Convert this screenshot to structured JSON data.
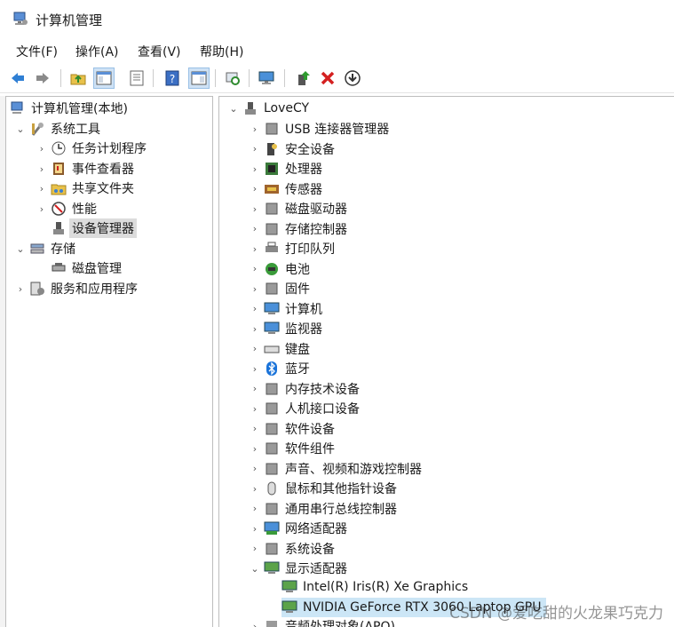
{
  "window": {
    "title": "计算机管理"
  },
  "menu": [
    "文件(F)",
    "操作(A)",
    "查看(V)",
    "帮助(H)"
  ],
  "toolbar": {
    "buttons": [
      "back-icon",
      "forward-icon",
      "up-folder-icon",
      "show-tree-icon",
      "properties-icon",
      "help-icon",
      "action-pane-icon",
      "scan-hardware-icon",
      "monitor-icon",
      "update-driver-icon",
      "uninstall-icon",
      "disable-device-icon"
    ]
  },
  "left_tree": {
    "root": "计算机管理(本地)",
    "system_tools": "系统工具",
    "task_scheduler": "任务计划程序",
    "event_viewer": "事件查看器",
    "shared_folders": "共享文件夹",
    "performance": "性能",
    "device_manager": "设备管理器",
    "storage": "存储",
    "disk_management": "磁盘管理",
    "services_apps": "服务和应用程序"
  },
  "device_tree": {
    "computer_name": "LoveCY",
    "categories": [
      "USB 连接器管理器",
      "安全设备",
      "处理器",
      "传感器",
      "磁盘驱动器",
      "存储控制器",
      "打印队列",
      "电池",
      "固件",
      "计算机",
      "监视器",
      "键盘",
      "蓝牙",
      "内存技术设备",
      "人机接口设备",
      "软件设备",
      "软件组件",
      "声音、视频和游戏控制器",
      "鼠标和其他指针设备",
      "通用串行总线控制器",
      "网络适配器",
      "系统设备",
      "显示适配器"
    ],
    "display_adapters": [
      "Intel(R) Iris(R) Xe Graphics",
      "NVIDIA GeForce RTX 3060 Laptop GPU"
    ],
    "partial_next": "音频处理对象(APO)"
  },
  "watermark": "CSDN @爱吃甜的火龙果巧克力",
  "colors": {
    "selection": "#cce6f6",
    "accent": "#1a73d9"
  }
}
